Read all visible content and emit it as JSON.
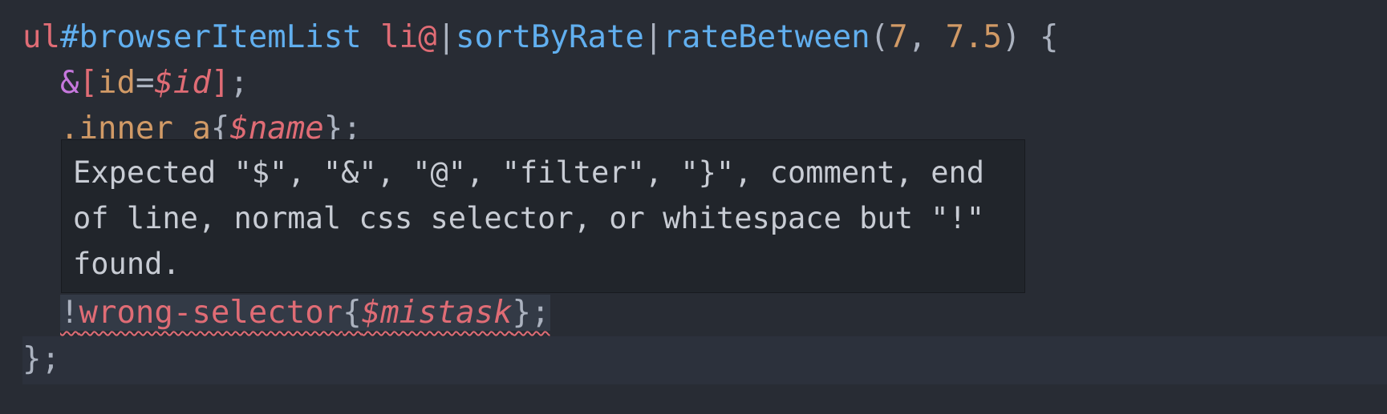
{
  "code": {
    "line1": {
      "selector": "ul",
      "id": "#browserItemList",
      "space": " ",
      "element": "li@",
      "pipe1": "|",
      "filter1": "sortByRate",
      "pipe2": "|",
      "filter2": "rateBetween",
      "paren_open": "(",
      "arg1": "7",
      "comma": ", ",
      "arg2": "7.5",
      "paren_close": ")",
      "brace_open": " {"
    },
    "line2": {
      "amp": "&",
      "bracket_open": "[",
      "attr": "id",
      "eq": "=",
      "var": "$id",
      "bracket_close": "]",
      "semi": ";"
    },
    "line3": {
      "selector": ".inner a",
      "brace_open": "{",
      "var": "$name",
      "brace_close": "};"
    },
    "line4": {
      "bang": "!",
      "selector": "wrong-selector",
      "brace_open": "{",
      "var": "$mistask",
      "brace_close": "};"
    },
    "line5": {
      "text": "};"
    }
  },
  "tooltip": {
    "message": "Expected \"$\", \"&\", \"@\", \"filter\", \"}\", comment, end of line, normal css selector, or whitespace but \"!\" found."
  },
  "colors": {
    "background": "#282c34",
    "error": "#e06c75",
    "function": "#61afef",
    "number": "#d19a66",
    "keyword": "#c678dd"
  }
}
